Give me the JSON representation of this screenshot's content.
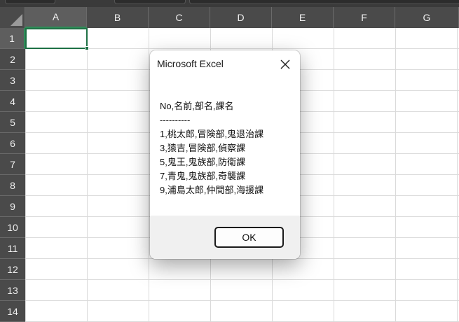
{
  "spreadsheet": {
    "columns": [
      "A",
      "B",
      "C",
      "D",
      "E",
      "F",
      "G"
    ],
    "rows": [
      "1",
      "2",
      "3",
      "4",
      "5",
      "6",
      "7",
      "8",
      "9",
      "10",
      "11",
      "12",
      "13",
      "14"
    ],
    "selected_cell": "A1"
  },
  "dialog": {
    "title": "Microsoft Excel",
    "message_lines": [
      "No,名前,部名,課名",
      "----------",
      "1,桃太郎,冒険部,鬼退治課",
      "3,猿吉,冒険部,偵察課",
      "5,鬼王,鬼族部,防衛課",
      "7,青鬼,鬼族部,奇襲課",
      "9,浦島太郎,仲間部,海援課"
    ],
    "ok_label": "OK"
  },
  "colors": {
    "header_bg": "#4a4a4a",
    "selection_green": "#1e7145",
    "gridline": "#dadada"
  },
  "icons": {
    "close": "close-icon",
    "select_all": "select-all-triangle-icon"
  }
}
